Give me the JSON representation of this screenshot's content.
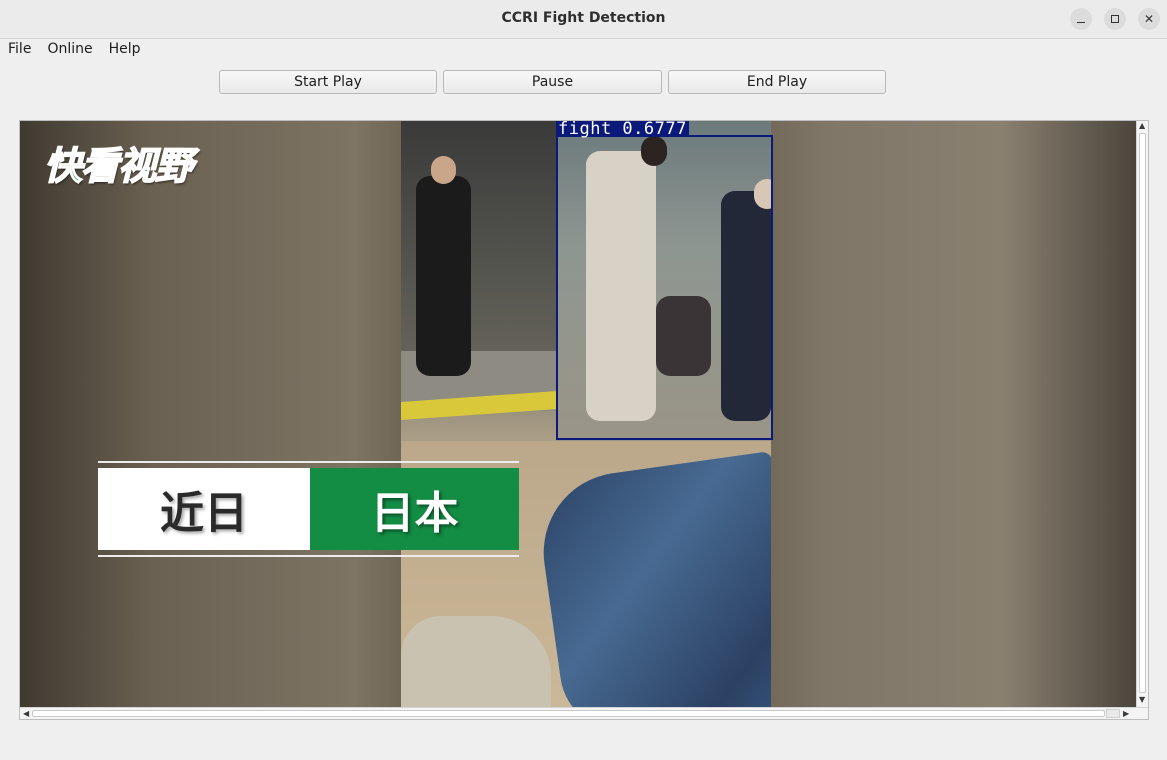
{
  "window": {
    "title": "CCRI Fight Detection",
    "controls": {
      "minimize_icon": "minimize-icon",
      "maximize_icon": "maximize-icon",
      "close_icon": "close-icon",
      "close_glyph": "✕"
    }
  },
  "menubar": {
    "items": [
      {
        "label": "File"
      },
      {
        "label": "Online"
      },
      {
        "label": "Help"
      }
    ]
  },
  "toolbar": {
    "start_label": "Start Play",
    "pause_label": "Pause",
    "end_label": "End Play"
  },
  "video": {
    "logo_text": "快看视野",
    "detection": {
      "label": "fight 0.6777",
      "box_color": "#0b1a7a"
    },
    "caption": {
      "left": "近日",
      "right": "日本",
      "right_bg": "#138c44"
    }
  },
  "scrollbars": {
    "up_arrow": "▲",
    "down_arrow": "▼",
    "left_arrow": "◀",
    "right_arrow": "▶"
  }
}
